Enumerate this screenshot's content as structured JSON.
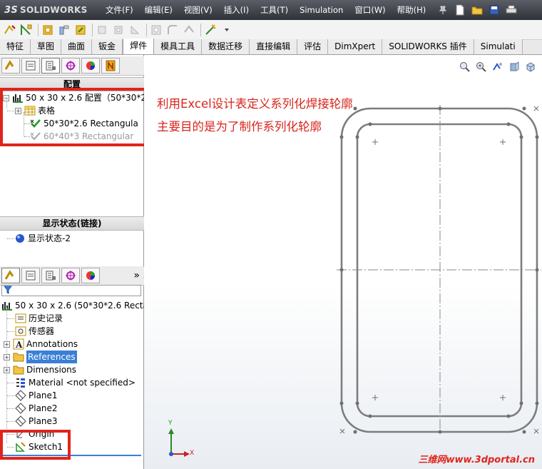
{
  "app": {
    "logo_text": "SOLIDWORKS",
    "menu": [
      "文件(F)",
      "编辑(E)",
      "视图(V)",
      "插入(I)",
      "工具(T)",
      "Simulation",
      "窗口(W)",
      "帮助(H)"
    ]
  },
  "tabs": [
    "特征",
    "草图",
    "曲面",
    "钣金",
    "焊件",
    "模具工具",
    "数据迁移",
    "直接编辑",
    "评估",
    "DimXpert",
    "SOLIDWORKS 插件",
    "Simulati"
  ],
  "active_tab": "焊件",
  "config_manager": {
    "header": "配置",
    "root": "50 x 30 x 2.6 配置（50*30*2",
    "table": "表格",
    "configs": [
      {
        "label": "50*30*2.6 Rectangula",
        "active": true
      },
      {
        "label": "60*40*3 Rectangular",
        "active": false
      }
    ]
  },
  "display_state": {
    "header": "显示状态(链接)",
    "item": "显示状态-2"
  },
  "feature_tree": {
    "more_glyph": "»",
    "root": "50 x 30 x 2.6  (50*30*2.6 Recta",
    "items": [
      {
        "label": "历史记录",
        "icon": "history-icon",
        "expandable": false
      },
      {
        "label": "传感器",
        "icon": "sensor-icon",
        "expandable": false
      },
      {
        "label": "Annotations",
        "icon": "annotations-icon",
        "expandable": true
      },
      {
        "label": "References",
        "icon": "folder-icon",
        "expandable": true,
        "selected": true
      },
      {
        "label": "Dimensions",
        "icon": "folder-icon",
        "expandable": true
      },
      {
        "label": "Material <not specified>",
        "icon": "material-icon",
        "expandable": false
      },
      {
        "label": "Plane1",
        "icon": "plane-icon",
        "expandable": false
      },
      {
        "label": "Plane2",
        "icon": "plane-icon",
        "expandable": false
      },
      {
        "label": "Plane3",
        "icon": "plane-icon",
        "expandable": false
      },
      {
        "label": "Origin",
        "icon": "origin-icon",
        "expandable": false
      },
      {
        "label": "Sketch1",
        "icon": "sketch-icon",
        "expandable": false
      }
    ]
  },
  "annotation": {
    "line1": "利用Excel设计表定义系列化焊接轮廓",
    "line2": "主要目的是为了制作系列化轮廓"
  },
  "triad": {
    "x": "X",
    "y": "Y"
  },
  "watermark": "三维网www.3dportal.cn",
  "colors": {
    "accent_red": "#e0241c",
    "selection_blue": "#3a7fd5",
    "sketch_gray": "#7d7d7d"
  }
}
